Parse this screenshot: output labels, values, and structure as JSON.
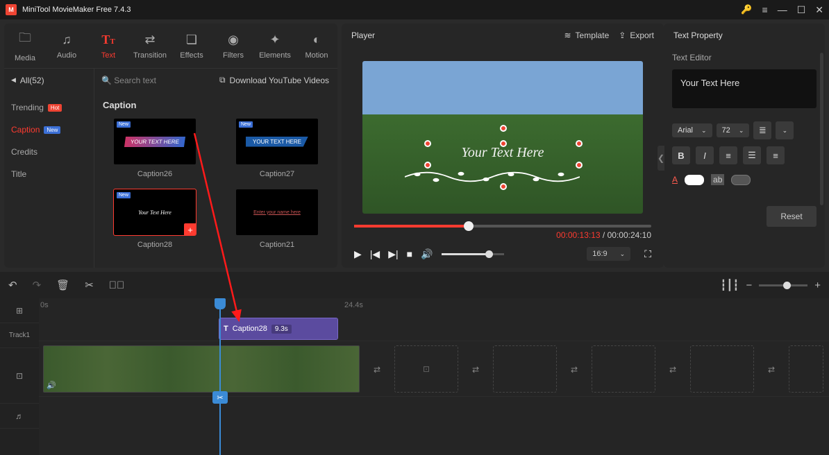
{
  "app": {
    "title": "MiniTool MovieMaker Free 7.4.3"
  },
  "toolbar": {
    "media": "Media",
    "audio": "Audio",
    "text": "Text",
    "transition": "Transition",
    "effects": "Effects",
    "filters": "Filters",
    "elements": "Elements",
    "motion": "Motion"
  },
  "library": {
    "all_count": "All(52)",
    "search_placeholder": "Search text",
    "download": "Download YouTube Videos",
    "side": {
      "trending": "Trending",
      "caption": "Caption",
      "credits": "Credits",
      "title": "Title",
      "hot": "Hot",
      "new": "New"
    },
    "section_title": "Caption",
    "items": [
      {
        "label": "Caption26",
        "preview": "YOUR TEXT HERE"
      },
      {
        "label": "Caption27",
        "preview": "YOUR TEXT HERE"
      },
      {
        "label": "Caption28",
        "preview": "Your Text Here",
        "selected": true
      },
      {
        "label": "Caption21",
        "preview": "Enter your name here"
      }
    ]
  },
  "player": {
    "title": "Player",
    "template": "Template",
    "export": "Export",
    "overlay_text": "Your Text Here",
    "current": "00:00:13:13",
    "total": "00:00:24:10",
    "aspect": "16:9"
  },
  "props": {
    "title": "Text Property",
    "editor": "Text Editor",
    "text_value": "Your Text Here",
    "font": "Arial",
    "size": "72",
    "reset": "Reset"
  },
  "timeline": {
    "ruler": {
      "t0": "0s",
      "t1": "24.4s"
    },
    "track1": "Track1",
    "clip": {
      "name": "Caption28",
      "duration": "9.3s"
    }
  }
}
